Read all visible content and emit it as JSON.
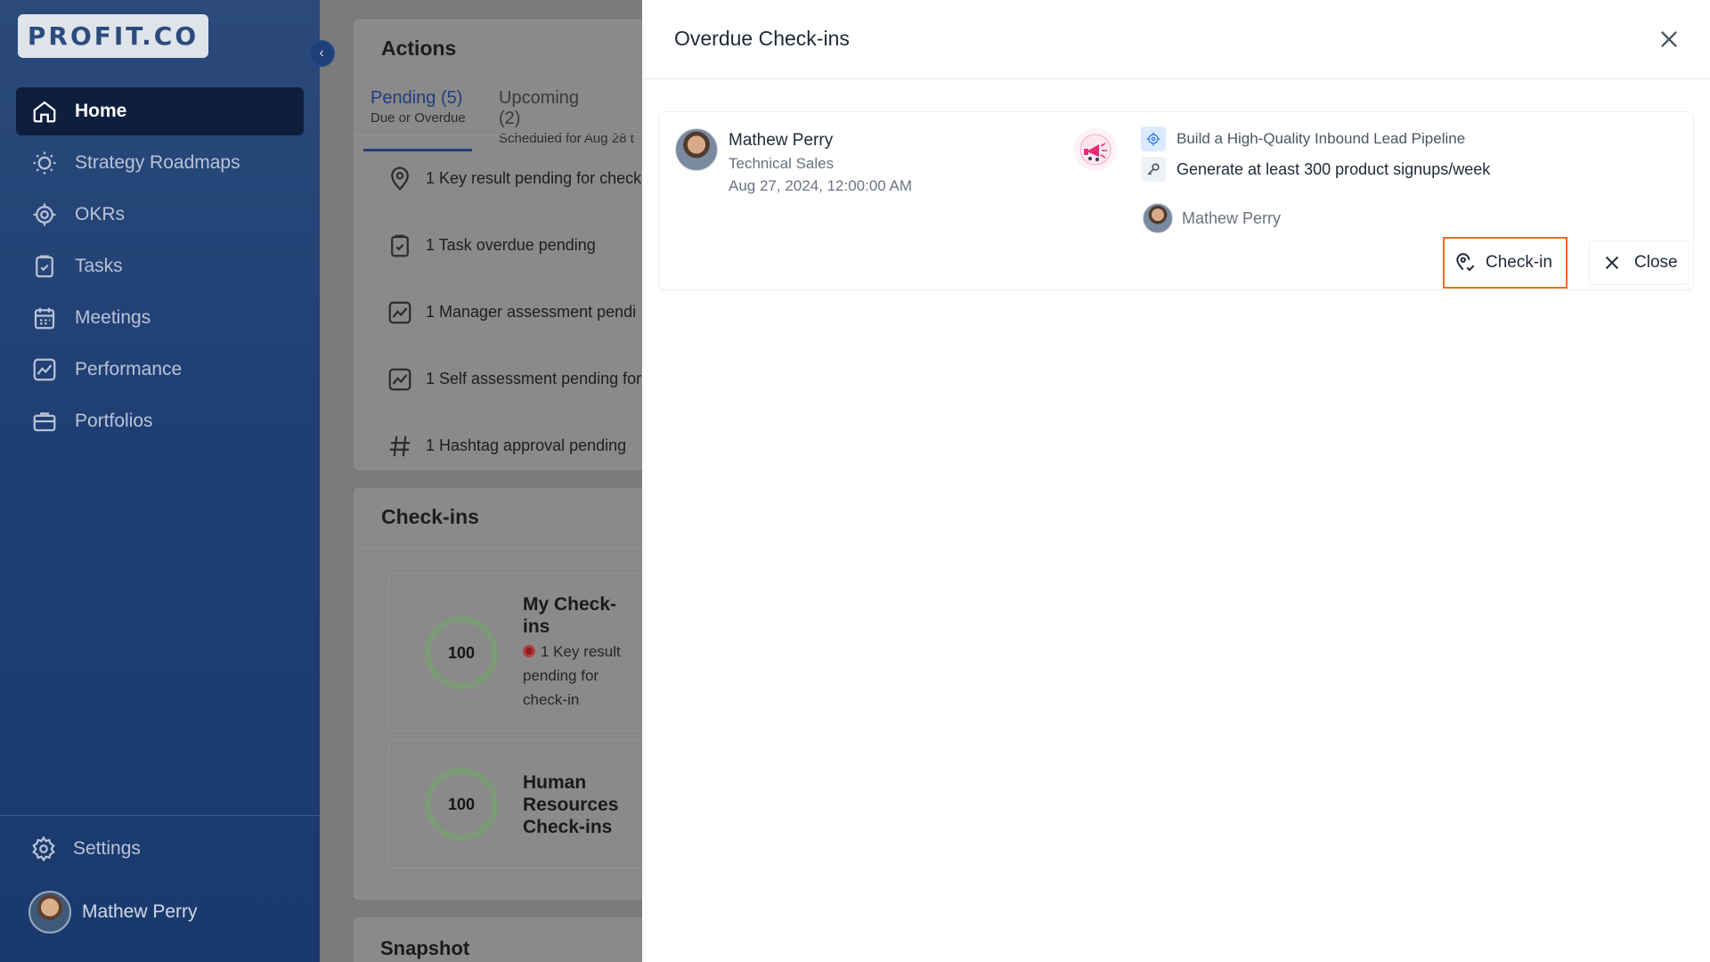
{
  "sidebar": {
    "logo": "PROFIT.CO",
    "items": [
      {
        "label": "Home",
        "icon": "home-icon",
        "active": true
      },
      {
        "label": "Strategy Roadmaps",
        "icon": "lightbulb-icon"
      },
      {
        "label": "OKRs",
        "icon": "target-icon"
      },
      {
        "label": "Tasks",
        "icon": "clipboard-check-icon"
      },
      {
        "label": "Meetings",
        "icon": "calendar-icon"
      },
      {
        "label": "Performance",
        "icon": "chart-line-icon"
      },
      {
        "label": "Portfolios",
        "icon": "briefcase-icon"
      }
    ],
    "settings_label": "Settings",
    "user_name": "Mathew Perry"
  },
  "actions": {
    "title": "Actions",
    "tabs": [
      {
        "label": "Pending (5)",
        "sub": "Due or Overdue"
      },
      {
        "label": "Upcoming (2)",
        "sub": "Scheduled for Aug 28 t"
      }
    ],
    "items": [
      {
        "text": "1 Key result pending for check",
        "icon": "location-pin-icon"
      },
      {
        "text": "1 Task overdue pending",
        "icon": "clipboard-check-icon"
      },
      {
        "text": "1 Manager assessment pendi",
        "icon": "chart-line-icon"
      },
      {
        "text": "1 Self assessment pending for",
        "icon": "chart-line-icon"
      },
      {
        "text": "1 Hashtag approval pending",
        "icon": "hashtag-icon"
      }
    ]
  },
  "checkins": {
    "title": "Check-ins",
    "cards": [
      {
        "score": "100",
        "title": "My Check-ins",
        "sub": "1 Key result pending for check-in"
      },
      {
        "score": "100",
        "title": "Human Resources Check-ins"
      }
    ]
  },
  "snapshot": {
    "title": "Snapshot"
  },
  "drawer": {
    "title": "Overdue Check-ins",
    "item": {
      "name": "Mathew Perry",
      "role": "Technical Sales",
      "date": "Aug 27, 2024, 12:00:00 AM",
      "objective": "Build a High-Quality Inbound Lead Pipeline",
      "key_result": "Generate at least 300 product signups/week",
      "owner": "Mathew Perry",
      "checkin_label": "Check-in",
      "close_label": "Close"
    }
  },
  "colors": {
    "accent": "#ef6c1e",
    "sidebar": "#1f3f74",
    "active_nav": "#0e1e3d"
  }
}
